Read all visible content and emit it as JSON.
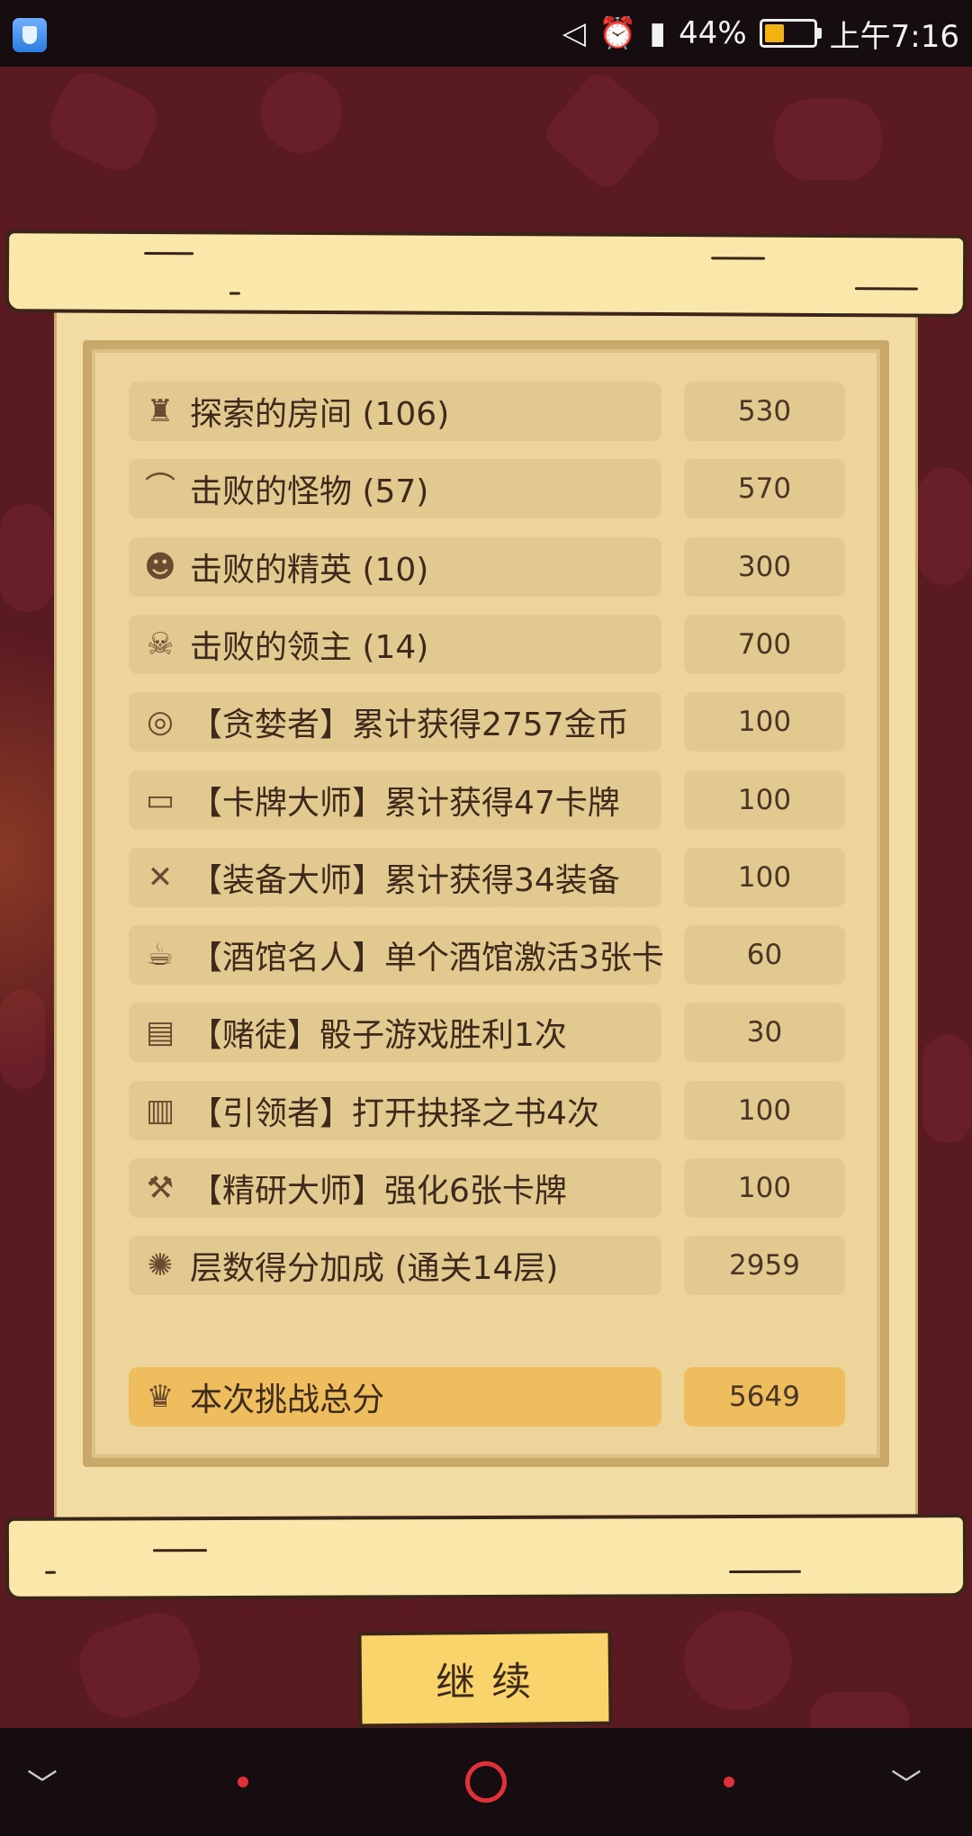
{
  "status_bar": {
    "battery_percent": "44%",
    "battery_level": 0.44,
    "time": "上午7:16",
    "icons": [
      "shield-app-icon",
      "silent-mode-icon",
      "alarm-icon",
      "signal-icon",
      "battery-icon"
    ]
  },
  "results": {
    "rows": [
      {
        "icon": "castle-icon",
        "label": "探索的房间 (106)",
        "value": "530"
      },
      {
        "icon": "bat-icon",
        "label": "击败的怪物 (57)",
        "value": "570"
      },
      {
        "icon": "demon-face-icon",
        "label": "击败的精英 (10)",
        "value": "300"
      },
      {
        "icon": "horned-skull-icon",
        "label": "击败的领主 (14)",
        "value": "700"
      },
      {
        "icon": "coin-stack-icon",
        "label": "【贪婪者】累计获得2757金币",
        "value": "100"
      },
      {
        "icon": "cards-icon",
        "label": "【卡牌大师】累计获得47卡牌",
        "value": "100"
      },
      {
        "icon": "equipment-icon",
        "label": "【装备大师】累计获得34装备",
        "value": "100"
      },
      {
        "icon": "beer-mug-icon",
        "label": "【酒馆名人】单个酒馆激活3张卡",
        "value": "60"
      },
      {
        "icon": "dice-book-icon",
        "label": "【赌徒】骰子游戏胜利1次",
        "value": "30"
      },
      {
        "icon": "open-book-icon",
        "label": "【引领者】打开抉择之书4次",
        "value": "100"
      },
      {
        "icon": "hammer-icon",
        "label": "【精研大师】强化6张卡牌",
        "value": "100"
      },
      {
        "icon": "floor-badge-icon",
        "label": "层数得分加成 (通关14层)",
        "value": "2959"
      }
    ],
    "total": {
      "icon": "trophy-icon",
      "label": "本次挑战总分",
      "value": "5649"
    }
  },
  "continue_button": {
    "label": "继续"
  },
  "colors": {
    "background": "#5a1a22",
    "parchment": "#f3dca4",
    "row_box": "#e2c98f",
    "total_box": "#edbd5e",
    "button": "#f9d46a",
    "nav_accent": "#e0303a"
  }
}
